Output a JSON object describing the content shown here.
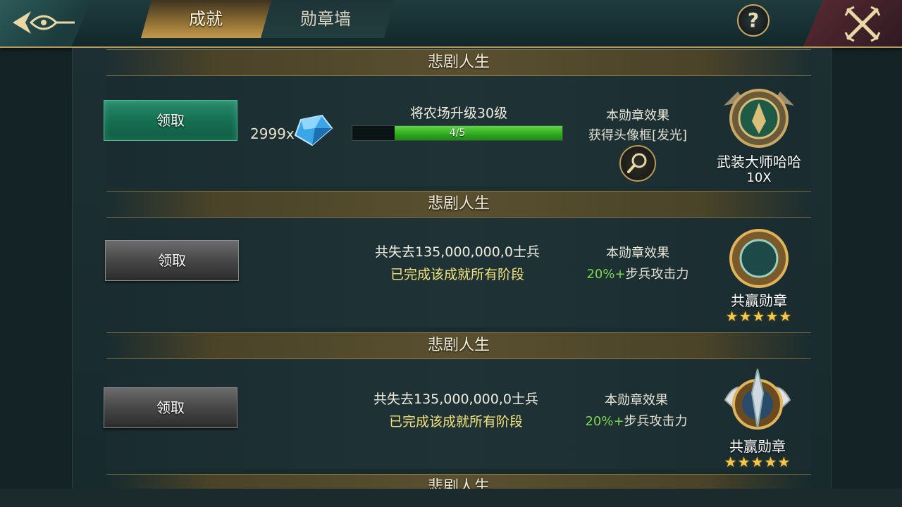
{
  "tabs": [
    {
      "label": "成就",
      "active": true
    },
    {
      "label": "勋章墙",
      "active": false
    }
  ],
  "help": {
    "label": "?"
  },
  "sections": [
    {
      "banner": "悲剧人生",
      "claim_label": "领取",
      "claim_state": "active",
      "reward_qty": "2999x",
      "reward_icon": "blue-gem-icon",
      "task": "将农场升级30级",
      "progress": {
        "text": "4/5",
        "current": 4,
        "total": 5
      },
      "effect_title": "本勋章效果",
      "effect_desc": "获得头像框[发光]",
      "medal_name": "武装大师哈哈",
      "medal_sub": "10X"
    },
    {
      "banner": "悲剧人生",
      "claim_label": "领取",
      "claim_state": "disabled",
      "task": "共失去135,000,000,0士兵",
      "done_text": "已完成该成就所有阶段",
      "effect_title": "本勋章效果",
      "effect_value": "20%+",
      "effect_desc": "步兵攻击力",
      "medal_name": "共赢勋章",
      "stars": "★★★★★",
      "star_count": 5
    },
    {
      "banner": "悲剧人生",
      "claim_label": "领取",
      "claim_state": "disabled",
      "task": "共失去135,000,000,0士兵",
      "done_text": "已完成该成就所有阶段",
      "effect_title": "本勋章效果",
      "effect_value": "20%+",
      "effect_desc": "步兵攻击力",
      "medal_name": "共赢勋章",
      "stars": "★★★★★",
      "star_count": 5
    },
    {
      "banner": "悲剧人生"
    }
  ],
  "colors": {
    "progress_green": "#2ea81e",
    "claim_green": "#167052",
    "done_yellow": "#f4e27a",
    "effect_green": "#7cd84e",
    "star_gold": "#f2c94c"
  }
}
